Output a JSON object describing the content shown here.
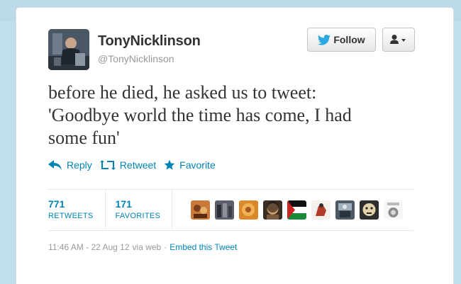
{
  "user": {
    "display_name": "TonyNicklinson",
    "screen_name": "@TonyNicklinson",
    "avatar_icon": "profile-photo"
  },
  "buttons": {
    "follow_label": "Follow",
    "user_dropdown_icon": "user-menu-icon"
  },
  "tweet": {
    "text": "before he died, he asked us to tweet:\n'Goodbye world the time has come, I had\nsome fun'"
  },
  "actions": {
    "reply": "Reply",
    "retweet": "Retweet",
    "favorite": "Favorite"
  },
  "stats": {
    "retweets_count": "771",
    "retweets_label": "RETWEETS",
    "favorites_count": "171",
    "favorites_label": "FAVORITES"
  },
  "faces_count": 9,
  "footer": {
    "time": "11:46 AM - 22 Aug 12",
    "via": "via web",
    "separator": "·",
    "embed": "Embed this Tweet"
  },
  "colors": {
    "link": "#0084b4",
    "text": "#333333",
    "muted": "#999999",
    "page_background": "#c0deed"
  }
}
